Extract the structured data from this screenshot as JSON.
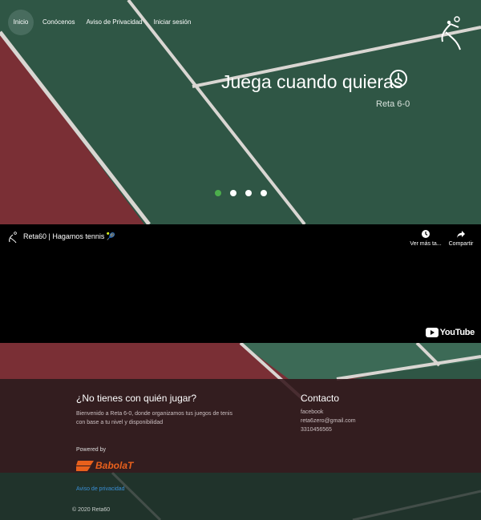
{
  "nav": {
    "items": [
      {
        "label": "Inicio",
        "active": true
      },
      {
        "label": "Conócenos"
      },
      {
        "label": "Aviso de Privacidad"
      },
      {
        "label": "Iniciar sesión"
      }
    ]
  },
  "hero": {
    "title": "Juega cuando quieras",
    "subtitle": "Reta 6-0",
    "slide_count": 4,
    "active_slide": 1,
    "icon": "clock-icon"
  },
  "video": {
    "title": "Reta60 | Hagamos tennis 🎾",
    "watch_later_label": "Ver más ta...",
    "share_label": "Compartir",
    "brand": "YouTube"
  },
  "footer": {
    "about_heading": "¿No tienes con quién jugar?",
    "about_line1": "Bienvenido a Reta 6-0, donde organizamos tus juegos de tenis",
    "about_line2": "con base a tu nivel y disponibilidad",
    "contact_heading": "Contacto",
    "contact_facebook": "facebook",
    "contact_email": "reta6zero@gmail.com",
    "contact_phone": "3310456565",
    "powered_by": "Powered by",
    "sponsor_logo_text": "Babolat",
    "privacy_link": "Aviso de privacidad",
    "copyright": "© 2020 Reta60"
  },
  "colors": {
    "court_green": "#2f5645",
    "court_red": "#7a2f35",
    "active_dot": "#4cae4c",
    "link_blue": "#3a8fd6"
  }
}
